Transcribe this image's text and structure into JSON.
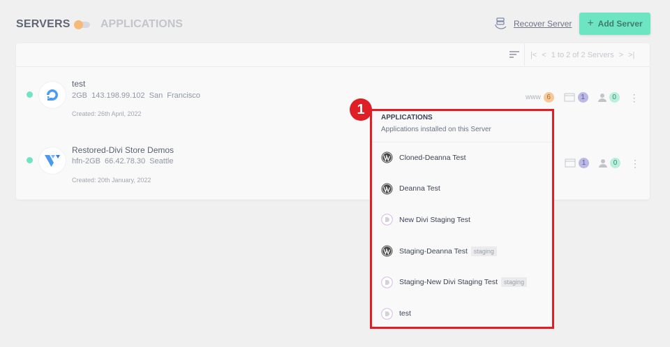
{
  "header": {
    "tab_servers": "SERVERS",
    "tab_applications": "APPLICATIONS",
    "recover_label": "Recover Server",
    "add_label": "Add Server"
  },
  "pager": {
    "text": "1 to 2 of 2 Servers"
  },
  "servers": [
    {
      "name": "test",
      "size": "2GB",
      "ip": "143.198.99.102",
      "location": "San Francisco",
      "created": "Created: 26th April, 2022",
      "provider": "digitalocean",
      "www_label": "www",
      "apps": "6",
      "dbs": "1",
      "users": "0",
      "status_color": "#6ee5c2"
    },
    {
      "name": "Restored-Divi Store Demos",
      "size": "hfn-2GB",
      "ip": "66.42.78.30",
      "location": "Seattle",
      "created": "Created: 20th January, 2022",
      "provider": "vultr",
      "dbs": "1",
      "users": "0",
      "status_color": "#6ee5c2"
    }
  ],
  "popup": {
    "title": "APPLICATIONS",
    "subtitle": "Applications installed on this Server",
    "items": [
      {
        "name": "Cloned-Deanna Test",
        "icon": "wordpress-icon"
      },
      {
        "name": "Deanna Test",
        "icon": "wordpress-icon"
      },
      {
        "name": "New Divi Staging Test",
        "icon": "divi-icon"
      },
      {
        "name": "Staging-Deanna Test",
        "icon": "wordpress-icon",
        "tag": "staging"
      },
      {
        "name": "Staging-New Divi Staging Test",
        "icon": "divi-icon",
        "tag": "staging"
      },
      {
        "name": "test",
        "icon": "divi-icon"
      }
    ]
  },
  "annotation": {
    "step": "1",
    "color": "#e01e26"
  }
}
